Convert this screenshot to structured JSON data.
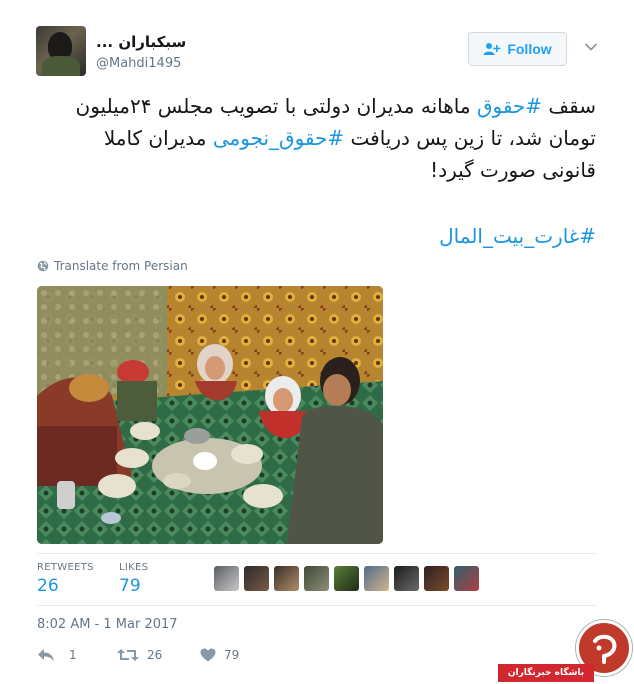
{
  "user": {
    "display_name": "سبکباران ...",
    "username": "@Mahdi1495"
  },
  "follow_label": "Follow",
  "tweet": {
    "line1_a": "سقف ",
    "line1_hash": "#حقوق",
    "line1_b": " ماهانه مدیران دولتی با تصویب مجلس ۲۴میلیون",
    "line2_a": "تومان شد، تا زین پس دریافت ",
    "line2_hash": "#حقوق_نجومی",
    "line2_b": " مدیران کاملا",
    "line3": "قانونی صورت گیرد!",
    "hashtag": "#غارت_بیت_المال"
  },
  "translate_label": "Translate from Persian",
  "stats": {
    "retweets_label": "RETWEETS",
    "retweets_value": "26",
    "likes_label": "LIKES",
    "likes_value": "79"
  },
  "timestamp": "8:02 AM - 1 Mar 2017",
  "actions": {
    "reply_count": "1",
    "retweet_count": "26",
    "like_count": "79"
  },
  "watermark": {
    "label": "باشگاه خبرنگاران"
  },
  "colors": {
    "link": "#1b95e0",
    "muted": "#657786",
    "follow_text": "#1da1f2",
    "watermark_red": "#d0282e"
  },
  "icons": [
    "follow-user-icon",
    "chevron-down-icon",
    "globe-icon",
    "reply-icon",
    "retweet-icon",
    "heart-icon"
  ]
}
